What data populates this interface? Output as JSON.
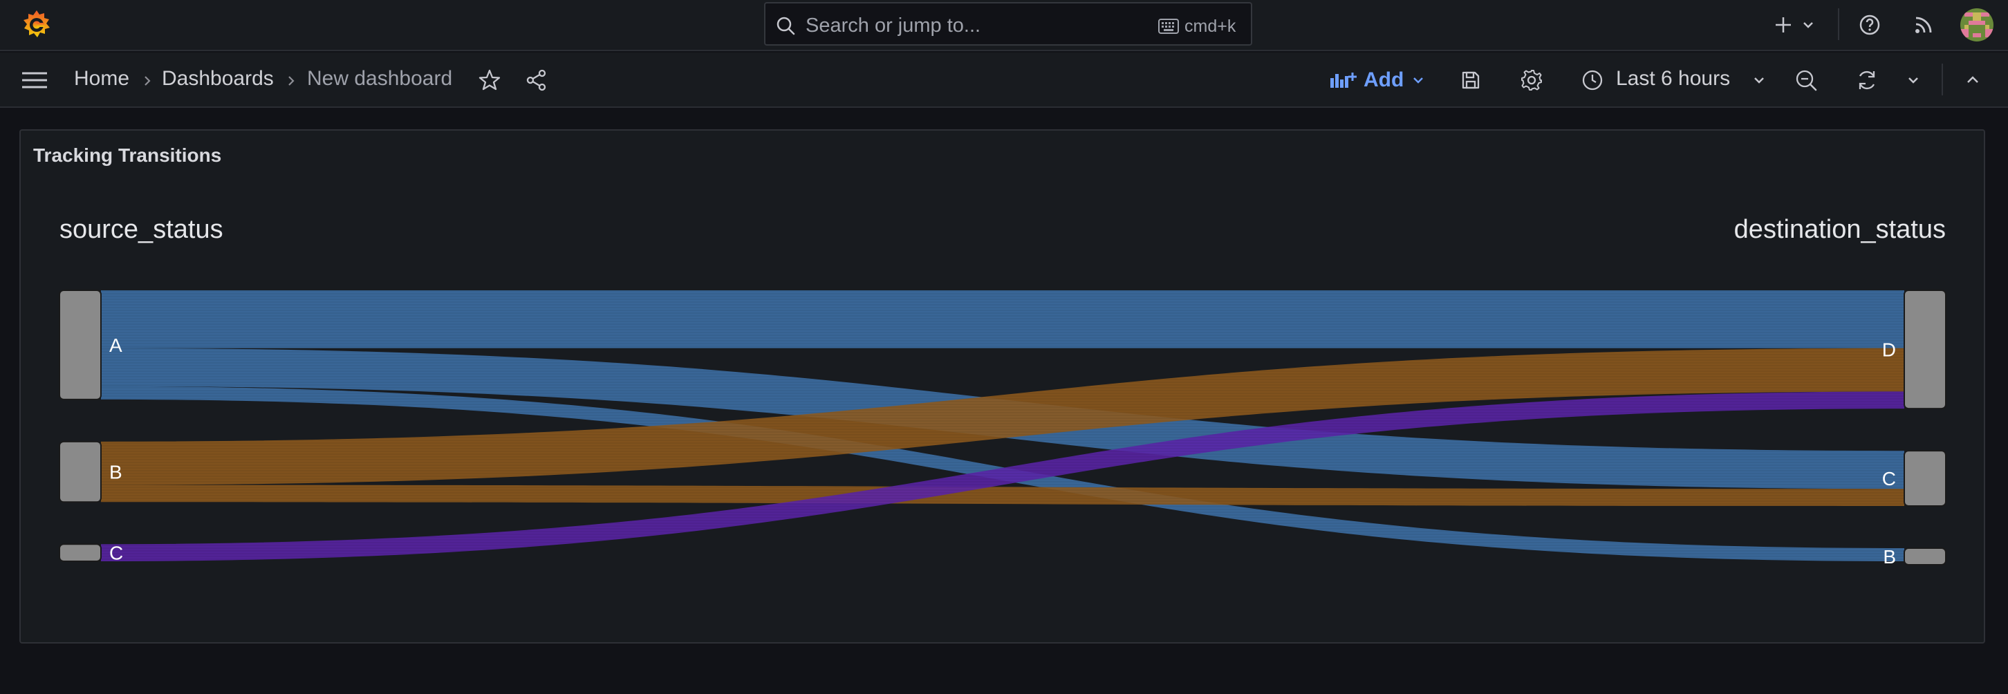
{
  "topbar": {
    "search_placeholder": "Search or jump to...",
    "search_shortcut": "cmd+k",
    "icons": [
      "grafana-logo-icon",
      "search-icon",
      "keyboard-icon",
      "plus-icon",
      "chevron-down-icon",
      "help-icon",
      "rss-icon",
      "avatar"
    ]
  },
  "navbar": {
    "breadcrumbs": [
      "Home",
      "Dashboards",
      "New dashboard"
    ],
    "add_label": "Add",
    "time_range": "Last 6 hours"
  },
  "panel": {
    "title": "Tracking Transitions"
  },
  "chart_data": {
    "type": "sankey",
    "source_header": "source_status",
    "destination_header": "destination_status",
    "source_nodes": [
      "A",
      "B",
      "C"
    ],
    "destination_nodes": [
      "D",
      "C",
      "B"
    ],
    "links": [
      {
        "source": "A",
        "target": "D",
        "value": 44,
        "color": "#3d71a8"
      },
      {
        "source": "A",
        "target": "C",
        "value": 29,
        "color": "#3d71a8"
      },
      {
        "source": "A",
        "target": "B",
        "value": 10,
        "color": "#3d71a8"
      },
      {
        "source": "B",
        "target": "D",
        "value": 33,
        "color": "#8e5a1e"
      },
      {
        "source": "B",
        "target": "C",
        "value": 13,
        "color": "#8e5a1e"
      },
      {
        "source": "C",
        "target": "D",
        "value": 13,
        "color": "#5a24a8"
      }
    ],
    "node_color": "#8a8a8a",
    "colors": {
      "A": "#3d71a8",
      "B": "#8e5a1e",
      "C": "#5a24a8"
    }
  }
}
